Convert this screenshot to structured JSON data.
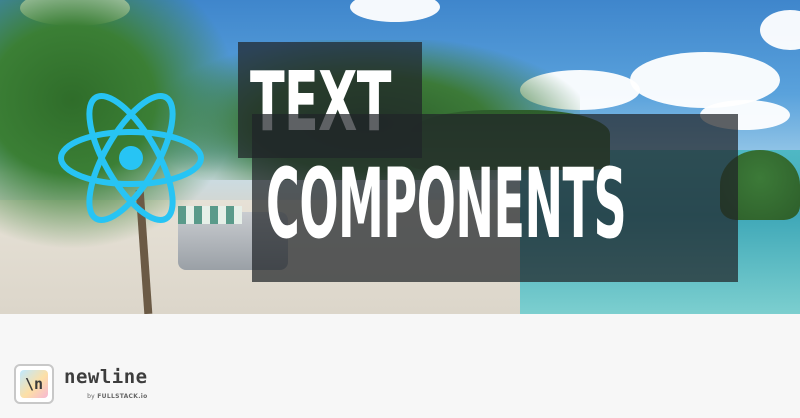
{
  "hero": {
    "title_line_1": "TEXT",
    "title_line_2": "COMPONENTS",
    "logo_icon": "react-atom-icon",
    "logo_color": "#27c4f4"
  },
  "footer": {
    "brand_mark": "\\n",
    "brand_name": "newline",
    "brand_sub_prefix": "by",
    "brand_sub_company": "FULLSTACK.io"
  }
}
